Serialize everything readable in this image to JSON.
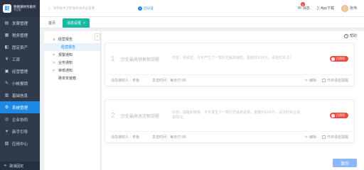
{
  "brand": {
    "logo": "财",
    "name": "税捷通财务服务",
    "sub": "专业版"
  },
  "sidebar": {
    "items": [
      {
        "label": "发票管理",
        "icon": "invoice-icon",
        "glyph": "▤"
      },
      {
        "label": "税务管理",
        "icon": "tax-icon",
        "glyph": "▦"
      },
      {
        "label": "固定资产",
        "icon": "asset-icon",
        "glyph": "◧"
      },
      {
        "label": "工资",
        "icon": "salary-icon",
        "glyph": "¥"
      },
      {
        "label": "经营管理",
        "icon": "business-icon",
        "glyph": "▣"
      },
      {
        "label": "小帐报销",
        "icon": "expense-icon",
        "glyph": "✎"
      },
      {
        "label": "基础信息",
        "icon": "info-icon",
        "glyph": "▥"
      },
      {
        "label": "系统管理",
        "icon": "gear-icon",
        "glyph": "⚙"
      },
      {
        "label": "企业协同",
        "icon": "team-icon",
        "glyph": "◎"
      },
      {
        "label": "新手引导",
        "icon": "guide-icon",
        "glyph": "✦"
      },
      {
        "label": "应用中心",
        "icon": "apps-icon",
        "glyph": "▨"
      }
    ],
    "active_index": 7,
    "footer": "取消固定"
  },
  "topbar": {
    "search_placeholder": "财务助手全新服务请点击查看",
    "cert_label": "已认证",
    "message_label": "消息",
    "message_count": "5",
    "app_label": "App下载",
    "user_label": "张伟"
  },
  "tabs": [
    {
      "label": "首页",
      "active": false
    },
    {
      "label": "消息设置",
      "active": true
    }
  ],
  "tree": [
    {
      "label": "经营报告",
      "level": 0,
      "arrow": "∨",
      "selected": false
    },
    {
      "label": "经营报告",
      "level": 1,
      "arrow": "",
      "selected": true
    },
    {
      "label": "报警通知",
      "level": 0,
      "arrow": ">",
      "selected": false
    },
    {
      "label": "业务通知",
      "level": 0,
      "arrow": ">",
      "selected": false
    },
    {
      "label": "审核通知",
      "level": 0,
      "arrow": ">",
      "selected": false
    },
    {
      "label": "礁单安装箱",
      "level": 0,
      "arrow": "",
      "selected": false
    }
  ],
  "main": {
    "help_label": "帮助",
    "save_label": "保存",
    "cards": [
      {
        "num": "1",
        "title": "历史最高销售额提醒",
        "body": "内容：恭喜您，今天产生了一笔历史最高销售，金额共XXX元，请及时关注！",
        "toggle": "已停用",
        "receiver": "消息接收人：老板",
        "time": "发送时间：每天07:00",
        "edit": "编辑",
        "voice": "开启语音提醒"
      },
      {
        "num": "2",
        "title": "历史最高退货额提醒",
        "body": "内容：提醒知晓哦，今天发生了一笔历史最高退货，金额为XXX元，请及时关注退货情况。",
        "toggle": "已停用",
        "receiver": "消息接收人：老板",
        "time": "发送时间：每天07:00",
        "edit": "编辑",
        "voice": "开启语音提醒"
      }
    ]
  },
  "colors": {
    "sidebar_bg": "#2f3a4b",
    "active_menu": "#1e88e5",
    "active_tab": "#18b9a3",
    "toggle_off": "#ef4b3e",
    "save_button": "#8ab8f4"
  }
}
